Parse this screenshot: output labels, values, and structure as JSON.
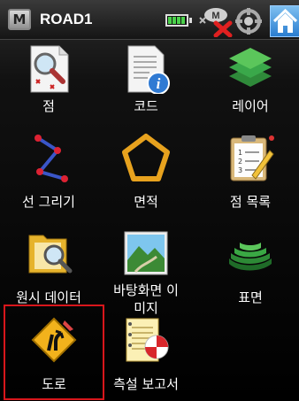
{
  "statusbar": {
    "menu_letter": "M",
    "title": "ROAD1",
    "sat_letter": "M"
  },
  "items": [
    {
      "label": "점"
    },
    {
      "label": "코드"
    },
    {
      "label": "레이어"
    },
    {
      "label": "선 그리기"
    },
    {
      "label": "면적"
    },
    {
      "label": "점 목록"
    },
    {
      "label": "원시 데이터"
    },
    {
      "label_line1": "바탕화면 이",
      "label_line2": "미지"
    },
    {
      "label": "표면"
    },
    {
      "label": "도로"
    },
    {
      "label": "측설 보고서"
    }
  ],
  "colors": {
    "selection": "#d8161b",
    "accent": "#2a7dd0"
  }
}
